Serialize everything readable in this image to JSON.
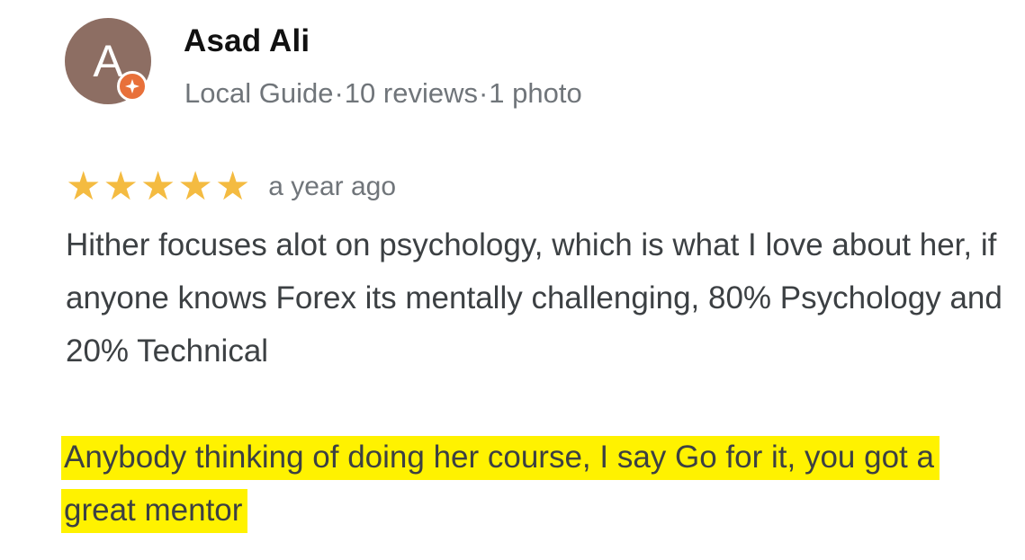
{
  "reviewer": {
    "avatar_letter": "A",
    "avatar_color": "#8d6e63",
    "badge_icon": "local-guide-star-icon",
    "badge_color": "#e8703a",
    "name": "Asad Ali",
    "guide_label": "Local Guide",
    "separator": "·",
    "reviews_count": "10 reviews",
    "photos_count": "1 photo"
  },
  "review": {
    "rating": 5,
    "rating_max": 5,
    "star_glyph": "★",
    "star_color": "#f4bb41",
    "time_ago": "a year ago",
    "paragraph_1": "Hither focuses alot on psychology, which is what I love about her, if anyone knows Forex its mentally challenging, 80% Psychology and 20% Technical",
    "paragraph_2": "Anybody thinking of doing her course, I say Go for it, you got a great mentor",
    "highlight_color": "#fff200"
  }
}
